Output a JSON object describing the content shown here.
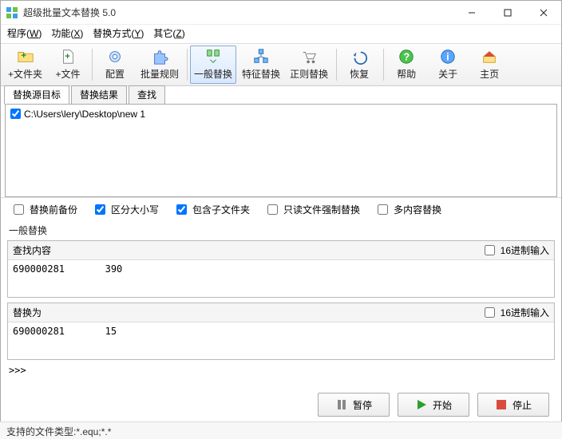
{
  "window": {
    "title": "超级批量文本替换 5.0"
  },
  "menubar": {
    "items": [
      {
        "label": "程序",
        "accel": "W"
      },
      {
        "label": "功能",
        "accel": "X"
      },
      {
        "label": "替换方式",
        "accel": "Y"
      },
      {
        "label": "其它",
        "accel": "Z"
      }
    ]
  },
  "toolbar": {
    "buttons": [
      {
        "id": "add-folder",
        "label": "+文件夹"
      },
      {
        "id": "add-file",
        "label": "+文件"
      },
      {
        "id": "config",
        "label": "配置"
      },
      {
        "id": "batch-rule",
        "label": "批量规则"
      },
      {
        "id": "normal-replace",
        "label": "一般替换",
        "active": true
      },
      {
        "id": "feature-replace",
        "label": "特征替换"
      },
      {
        "id": "regex-replace",
        "label": "正则替换"
      },
      {
        "id": "restore",
        "label": "恢复"
      },
      {
        "id": "help",
        "label": "帮助"
      },
      {
        "id": "about",
        "label": "关于"
      },
      {
        "id": "home",
        "label": "主页"
      }
    ]
  },
  "tabs": {
    "items": [
      {
        "id": "source",
        "label": "替换源目标",
        "active": true
      },
      {
        "id": "result",
        "label": "替换结果"
      },
      {
        "id": "find",
        "label": "查找"
      }
    ],
    "source_list": [
      {
        "checked": true,
        "path": "C:\\Users\\lery\\Desktop\\new 1"
      }
    ]
  },
  "options": {
    "backup_before": {
      "label": "替换前备份",
      "checked": false
    },
    "case_sensitive": {
      "label": "区分大小写",
      "checked": true
    },
    "include_sub": {
      "label": "包含子文件夹",
      "checked": true
    },
    "readonly_force": {
      "label": "只读文件强制替换",
      "checked": false
    },
    "multi_content": {
      "label": "多内容替换",
      "checked": false
    }
  },
  "section_title": "一般替换",
  "find_group": {
    "title": "查找内容",
    "hex_label": "16进制输入",
    "hex_checked": false,
    "content": "690000281       390"
  },
  "replace_group": {
    "title": "替换为",
    "hex_label": "16进制输入",
    "hex_checked": false,
    "content": "690000281       15"
  },
  "console_prompt": ">>>",
  "actions": {
    "pause": "暂停",
    "start": "开始",
    "stop": "停止"
  },
  "statusbar": "支持的文件类型:*.equ;*.*"
}
